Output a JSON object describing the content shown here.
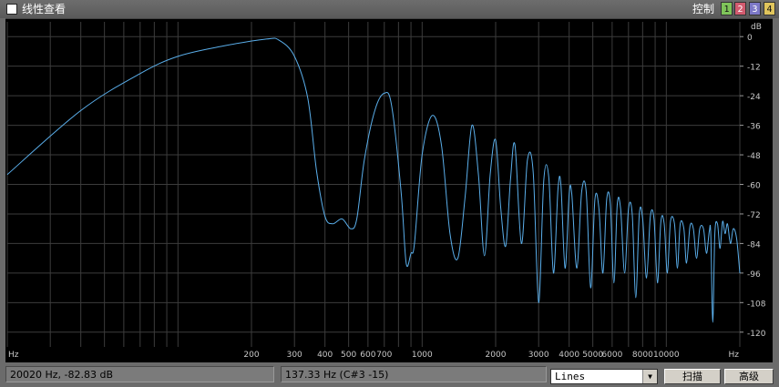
{
  "window": {
    "title": "线性查看",
    "control_label": "控制"
  },
  "channels": [
    "1",
    "2",
    "3",
    "4"
  ],
  "chart_data": {
    "type": "line",
    "x_scale": "log",
    "xlim": [
      20,
      20000
    ],
    "ylim": [
      -126,
      6
    ],
    "ylabel": "dB",
    "xlabel": "Hz",
    "x_tick_labels": [
      {
        "value": 20,
        "label": "Hz"
      },
      {
        "value": 200,
        "label": "200"
      },
      {
        "value": 300,
        "label": "300"
      },
      {
        "value": 400,
        "label": "400"
      },
      {
        "value": 500,
        "label": "500"
      },
      {
        "value": 600,
        "label": "600"
      },
      {
        "value": 700,
        "label": "700"
      },
      {
        "value": 1000,
        "label": "1000"
      },
      {
        "value": 2000,
        "label": "2000"
      },
      {
        "value": 3000,
        "label": "3000"
      },
      {
        "value": 4000,
        "label": "4000"
      },
      {
        "value": 5000,
        "label": "5000"
      },
      {
        "value": 6000,
        "label": "6000"
      },
      {
        "value": 8000,
        "label": "8000"
      },
      {
        "value": 10000,
        "label": "10000"
      },
      {
        "value": 20000,
        "label": "Hz"
      }
    ],
    "y_tick_labels": [
      {
        "value": 0,
        "label": "0"
      },
      {
        "value": -12,
        "label": "-12"
      },
      {
        "value": -24,
        "label": "-24"
      },
      {
        "value": -36,
        "label": "-36"
      },
      {
        "value": -48,
        "label": "-48"
      },
      {
        "value": -60,
        "label": "-60"
      },
      {
        "value": -72,
        "label": "-72"
      },
      {
        "value": -84,
        "label": "-84"
      },
      {
        "value": -96,
        "label": "-96"
      },
      {
        "value": -108,
        "label": "-108"
      },
      {
        "value": -120,
        "label": "-120"
      }
    ],
    "series": [
      {
        "color": "#5aaeea",
        "points": [
          [
            20,
            -56
          ],
          [
            40,
            -30
          ],
          [
            70,
            -15
          ],
          [
            100,
            -8
          ],
          [
            150,
            -4
          ],
          [
            230,
            -1
          ],
          [
            260,
            -1.5
          ],
          [
            300,
            -8
          ],
          [
            340,
            -25
          ],
          [
            370,
            -55
          ],
          [
            400,
            -73
          ],
          [
            430,
            -76
          ],
          [
            470,
            -74
          ],
          [
            510,
            -78
          ],
          [
            540,
            -74
          ],
          [
            580,
            -50
          ],
          [
            640,
            -30
          ],
          [
            700,
            -23
          ],
          [
            750,
            -28
          ],
          [
            820,
            -63
          ],
          [
            860,
            -92
          ],
          [
            900,
            -88
          ],
          [
            930,
            -84
          ],
          [
            1000,
            -48
          ],
          [
            1100,
            -32
          ],
          [
            1200,
            -44
          ],
          [
            1300,
            -80
          ],
          [
            1400,
            -90
          ],
          [
            1500,
            -65
          ],
          [
            1600,
            -36
          ],
          [
            1700,
            -56
          ],
          [
            1800,
            -89
          ],
          [
            1900,
            -56
          ],
          [
            2000,
            -42
          ],
          [
            2100,
            -70
          ],
          [
            2200,
            -85
          ],
          [
            2300,
            -58
          ],
          [
            2400,
            -44
          ],
          [
            2550,
            -84
          ],
          [
            2700,
            -50
          ],
          [
            2850,
            -55
          ],
          [
            3000,
            -108
          ],
          [
            3150,
            -58
          ],
          [
            3300,
            -57
          ],
          [
            3450,
            -96
          ],
          [
            3600,
            -62
          ],
          [
            3700,
            -60
          ],
          [
            3850,
            -94
          ],
          [
            4000,
            -64
          ],
          [
            4100,
            -64
          ],
          [
            4300,
            -94
          ],
          [
            4500,
            -63
          ],
          [
            4700,
            -63
          ],
          [
            4900,
            -102
          ],
          [
            5100,
            -66
          ],
          [
            5300,
            -70
          ],
          [
            5500,
            -96
          ],
          [
            5700,
            -66
          ],
          [
            5900,
            -68
          ],
          [
            6100,
            -100
          ],
          [
            6300,
            -68
          ],
          [
            6500,
            -70
          ],
          [
            6750,
            -96
          ],
          [
            7000,
            -70
          ],
          [
            7250,
            -72
          ],
          [
            7500,
            -106
          ],
          [
            7750,
            -72
          ],
          [
            8000,
            -74
          ],
          [
            8300,
            -98
          ],
          [
            8600,
            -73
          ],
          [
            8900,
            -74
          ],
          [
            9200,
            -100
          ],
          [
            9500,
            -75
          ],
          [
            9800,
            -76
          ],
          [
            10100,
            -96
          ],
          [
            10400,
            -75
          ],
          [
            10800,
            -76
          ],
          [
            11100,
            -94
          ],
          [
            11400,
            -76
          ],
          [
            11800,
            -78
          ],
          [
            12100,
            -92
          ],
          [
            12500,
            -77
          ],
          [
            12900,
            -78
          ],
          [
            13300,
            -90
          ],
          [
            13700,
            -78
          ],
          [
            14200,
            -78
          ],
          [
            14600,
            -88
          ],
          [
            15000,
            -79
          ],
          [
            15200,
            -80
          ],
          [
            15500,
            -116
          ],
          [
            15800,
            -80
          ],
          [
            16200,
            -76
          ],
          [
            16600,
            -86
          ],
          [
            17000,
            -75
          ],
          [
            17400,
            -80
          ],
          [
            17800,
            -76
          ],
          [
            18300,
            -84
          ],
          [
            18800,
            -78
          ],
          [
            19400,
            -82
          ],
          [
            20000,
            -96
          ]
        ]
      }
    ]
  },
  "status": {
    "cursor_readout": "20020 Hz, -82.83 dB",
    "peak_readout": "137.33 Hz (C#3 -15)"
  },
  "mode_select": {
    "value": "Lines"
  },
  "buttons": {
    "scan": "扫描",
    "advanced": "高级"
  }
}
